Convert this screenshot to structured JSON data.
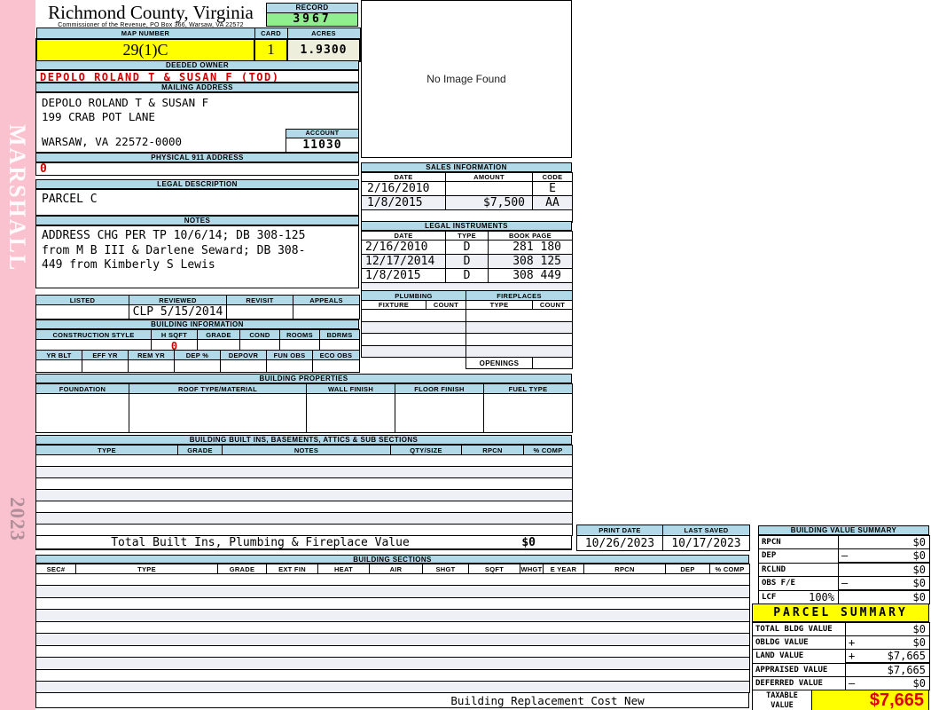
{
  "colors": {
    "header_blue": "#B2D9E8",
    "record_green": "#90EE90",
    "field_yellow": "#FFFF00",
    "acres_ivory": "#EEEEDD",
    "alert_red": "#CC0000",
    "page_pink": "#F9C2CE"
  },
  "sidebar": {
    "watermark": "MARSHALL",
    "year": "2023"
  },
  "header": {
    "title": "Richmond County, Virginia",
    "subtitle": "Commissioner of the Revenue, PO Box 366, Warsaw, VA 22572",
    "record_label": "RECORD",
    "record_value": "3967"
  },
  "identity": {
    "map_number_label": "MAP NUMBER",
    "map_number": "29(1)C",
    "card_label": "CARD",
    "card": "1",
    "acres_label": "ACRES",
    "acres": "1.9300",
    "deeded_owner_label": "DEEDED OWNER",
    "deeded_owner": "DEPOLO ROLAND T & SUSAN F (TOD)"
  },
  "mailing": {
    "label": "MAILING ADDRESS",
    "line1": "DEPOLO ROLAND T & SUSAN F",
    "line2": "199 CRAB POT LANE",
    "line3": "WARSAW, VA 22572-0000",
    "account_label": "ACCOUNT",
    "account": "11030"
  },
  "physical": {
    "label": "PHYSICAL 911 ADDRESS",
    "value": "0"
  },
  "legal": {
    "label": "LEGAL DESCRIPTION",
    "value": "PARCEL C"
  },
  "notes": {
    "label": "NOTES",
    "line1": "ADDRESS CHG PER TP 10/6/14; DB 308-125",
    "line2": "from M B III & Darlene Seward; DB 308-",
    "line3": "449 from Kimberly S Lewis"
  },
  "review": {
    "listed_label": "LISTED",
    "reviewed_label": "REVIEWED",
    "revisit_label": "REVISIT",
    "appeals_label": "APPEALS",
    "reviewed_value": "CLP  5/15/2014"
  },
  "image_box": {
    "text": "No Image Found"
  },
  "sales": {
    "title": "SALES INFORMATION",
    "col_date": "DATE",
    "col_amount": "AMOUNT",
    "col_code": "CODE",
    "rows": [
      {
        "date": "2/16/2010",
        "amount": "",
        "code": "E"
      },
      {
        "date": "1/8/2015",
        "amount": "$7,500",
        "code": "AA"
      }
    ]
  },
  "instruments": {
    "title": "LEGAL INSTRUMENTS",
    "col_date": "DATE",
    "col_type": "TYPE",
    "col_book": "BOOK PAGE",
    "rows": [
      {
        "date": "2/16/2010",
        "type": "D",
        "book": "281 180"
      },
      {
        "date": "12/17/2014",
        "type": "D",
        "book": "308 125"
      },
      {
        "date": "1/8/2015",
        "type": "D",
        "book": "308 449"
      }
    ]
  },
  "plumbing": {
    "title": "PLUMBING",
    "col_fixture": "FIXTURE",
    "col_count": "COUNT"
  },
  "fireplaces": {
    "title": "FIREPLACES",
    "col_type": "TYPE",
    "col_count": "COUNT",
    "openings_label": "OPENINGS"
  },
  "building_info": {
    "title": "BUILDING INFORMATION",
    "col_style": "CONSTRUCTION STYLE",
    "col_hsqft": "H SQFT",
    "col_grade": "GRADE",
    "col_cond": "COND",
    "col_rooms": "ROOMS",
    "col_bdrms": "BDRMS",
    "hsqft_value": "0",
    "col_yrblt": "YR BLT",
    "col_effyr": "EFF YR",
    "col_remyr": "REM YR",
    "col_dep": "DEP %",
    "col_depovr": "DEPOVR",
    "col_funobs": "FUN OBS",
    "col_ecoobs": "ECO OBS"
  },
  "building_props": {
    "title": "BUILDING PROPERTIES",
    "col_foundation": "FOUNDATION",
    "col_roof": "ROOF TYPE/MATERIAL",
    "col_wall": "WALL FINISH",
    "col_floor": "FLOOR FINISH",
    "col_fuel": "FUEL TYPE"
  },
  "built_ins": {
    "title": "BUILDING BUILT INS, BASEMENTS, ATTICS & SUB SECTIONS",
    "col_type": "TYPE",
    "col_grade": "GRADE",
    "col_notes": "NOTES",
    "col_qty": "QTY/SIZE",
    "col_rpcn": "RPCN",
    "col_comp": "% COMP",
    "total_label": "Total Built Ins, Plumbing & Fireplace Value",
    "total_value": "$0"
  },
  "print_info": {
    "print_label": "PRINT DATE",
    "print_value": "10/26/2023",
    "saved_label": "LAST SAVED",
    "saved_value": "10/17/2023"
  },
  "value_summary": {
    "title": "BUILDING VALUE SUMMARY",
    "rows": [
      {
        "label": "RPCN",
        "op": "",
        "value": "$0"
      },
      {
        "label": "DEP",
        "op": "–",
        "value": "$0"
      },
      {
        "label": "RCLND",
        "op": "",
        "value": "$0"
      },
      {
        "label": "OBS F/E",
        "op": "–",
        "value": "$0"
      },
      {
        "label": "LCF",
        "pct": "100%",
        "op": "",
        "value": "$0"
      }
    ]
  },
  "sections": {
    "title": "BUILDING SECTIONS",
    "col_sec": "SEC#",
    "col_type": "TYPE",
    "col_grade": "GRADE",
    "col_extfin": "EXT FIN",
    "col_heat": "HEAT",
    "col_air": "AIR",
    "col_shgt": "SHGT",
    "col_sqft": "SQFT",
    "col_whgt": "WHGT",
    "col_eyear": "E YEAR",
    "col_rpcn": "RPCN",
    "col_dep": "DEP",
    "col_comp": "% COMP",
    "footer": "Building Replacement Cost New"
  },
  "parcel_summary": {
    "title": "PARCEL SUMMARY",
    "rows": [
      {
        "label": "TOTAL BLDG VALUE",
        "op": "",
        "value": "$0"
      },
      {
        "label": "OBLDG VALUE",
        "op": "+",
        "value": "$0"
      },
      {
        "label": "LAND VALUE",
        "op": "+",
        "value": "$7,665"
      },
      {
        "label": "APPRAISED VALUE",
        "op": "",
        "value": "$7,665"
      },
      {
        "label": "DEFERRED VALUE",
        "op": "–",
        "value": "$0"
      }
    ],
    "taxable_label": "TAXABLE VALUE",
    "taxable_value": "$7,665"
  }
}
